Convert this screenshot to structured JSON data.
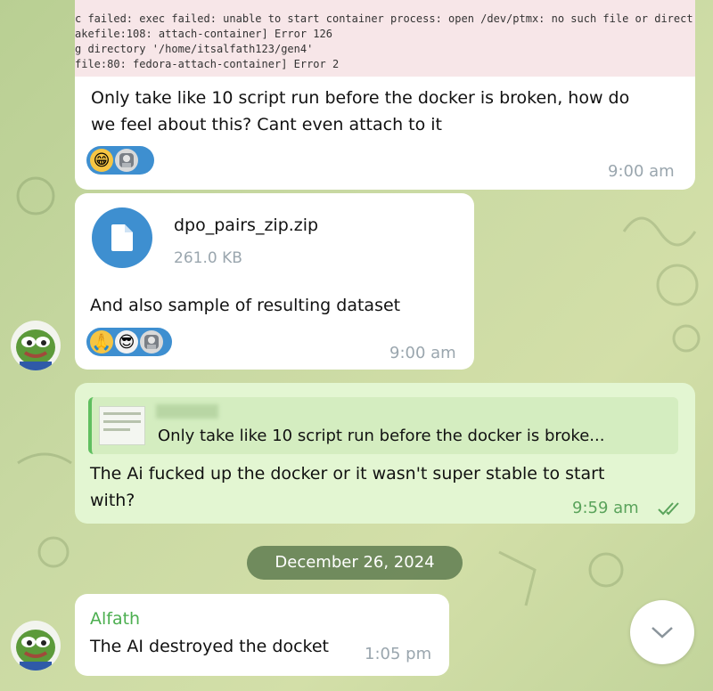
{
  "code_block": {
    "lines": [
      "c failed: exec failed: unable to start container process: open /dev/ptmx: no such file or direct",
      "akefile:108: attach-container] Error 126",
      "g directory '/home/itsalfath123/gen4'",
      "file:80: fedora-attach-container] Error 2"
    ]
  },
  "messages": [
    {
      "text_line1": "Only take like 10 script run before the docker is broken, how do",
      "text_line2": "we feel about this? Cant even attach to it",
      "time": "9:00 am",
      "reactions": [
        "😁",
        "avatar"
      ]
    },
    {
      "file_name": "dpo_pairs_zip.zip",
      "file_size": "261.0 KB",
      "text": "And also sample of resulting dataset",
      "time": "9:00 am",
      "reactions": [
        "🙏",
        "😎",
        "avatar"
      ]
    },
    {
      "reply_quote": "Only take like 10 script run before the docker is broke...",
      "text_line1": "The Ai fucked up the docker or it wasn't super stable to start",
      "text_line2": "with?",
      "time": "9:59 am",
      "status": "read"
    },
    {
      "sender": "Alfath",
      "text": "The AI destroyed the docket",
      "time": "1:05 pm"
    }
  ],
  "date_separator": "December 26, 2024",
  "colors": {
    "accent": "#3e8fd0",
    "outgoing_bubble": "#e3f6d2",
    "sender_name": "#4caf50",
    "date_pill": "#5f7d50"
  },
  "icons": {
    "file": "file-icon",
    "read_status": "double-check-icon",
    "scroll": "chevron-down-icon"
  }
}
